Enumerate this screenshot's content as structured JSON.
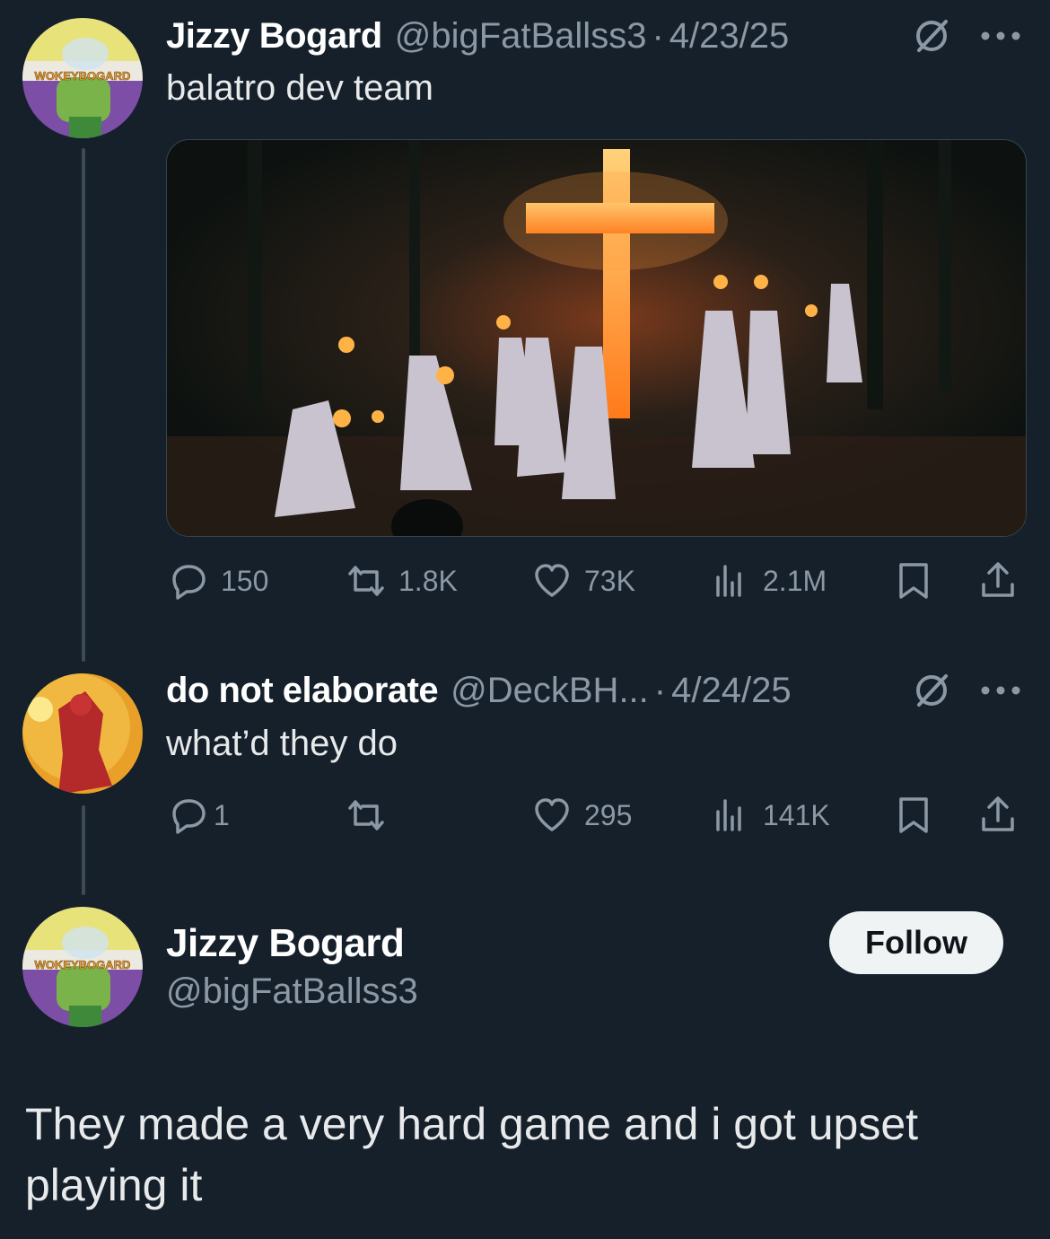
{
  "thread": [
    {
      "display_name": "Jizzy Bogard",
      "handle": "@bigFatBallss3",
      "date": "4/23/25",
      "text": "balatro dev team",
      "avatar_text": "WOKEYBOGARD",
      "has_media": true,
      "stats": {
        "replies": "150",
        "reposts": "1.8K",
        "likes": "73K",
        "views": "2.1M"
      }
    },
    {
      "display_name": "do not elaborate",
      "handle": "@DeckBH...",
      "date": "4/24/25",
      "text": "what’d they do",
      "stats": {
        "replies": "1",
        "reposts": "",
        "likes": "295",
        "views": "141K"
      }
    }
  ],
  "main_post": {
    "display_name": "Jizzy Bogard",
    "handle": "@bigFatBallss3",
    "avatar_text": "WOKEYBOGARD",
    "follow_label": "Follow",
    "text": "They made a very hard game and i got upset playing it"
  },
  "separator": "·",
  "colors": {
    "background": "#15202b",
    "muted": "#8b98a5",
    "text": "#e7e9ea",
    "line": "#3d4a57"
  },
  "icons": [
    "reply-icon",
    "repost-icon",
    "like-icon",
    "views-icon",
    "bookmark-icon",
    "share-icon",
    "grok-icon",
    "more-icon"
  ]
}
